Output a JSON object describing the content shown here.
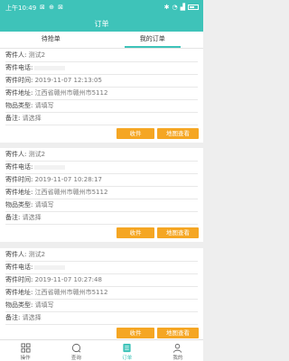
{
  "status": {
    "time": "上午10:49",
    "left_icons": "⊠ ⊕ ⊠"
  },
  "header": {
    "title": "订单"
  },
  "tabs": [
    {
      "label": "待抢单"
    },
    {
      "label": "我的订单"
    }
  ],
  "orders": [
    {
      "sender_label": "寄件人:",
      "sender": "测试2",
      "phone_label": "寄件电话:",
      "time_label": "寄件时间:",
      "time": "2019-11-07 12:13:05",
      "address_label": "寄件地址:",
      "address": "江西省赣州市赣州市5112",
      "type_label": "物品类型:",
      "type": "请填写",
      "note_label": "备注:",
      "note": "请选择",
      "btn_receive": "收件",
      "btn_map": "地图查看"
    },
    {
      "sender_label": "寄件人:",
      "sender": "测试2",
      "phone_label": "寄件电话:",
      "time_label": "寄件时间:",
      "time": "2019-11-07 10:28:17",
      "address_label": "寄件地址:",
      "address": "江西省赣州市赣州市5112",
      "type_label": "物品类型:",
      "type": "请填写",
      "note_label": "备注:",
      "note": "请选择",
      "btn_receive": "收件",
      "btn_map": "地图查看"
    },
    {
      "sender_label": "寄件人:",
      "sender": "测试2",
      "phone_label": "寄件电话:",
      "time_label": "寄件时间:",
      "time": "2019-11-07 10:27:48",
      "address_label": "寄件地址:",
      "address": "江西省赣州市赣州市5112",
      "type_label": "物品类型:",
      "type": "请填写",
      "note_label": "备注:",
      "note": "请选择",
      "btn_receive": "收件",
      "btn_map": "地图查看"
    }
  ],
  "nav": [
    {
      "label": "操作",
      "icon": "grid-icon"
    },
    {
      "label": "查询",
      "icon": "chat-icon"
    },
    {
      "label": "订单",
      "icon": "list-icon"
    },
    {
      "label": "我的",
      "icon": "person-icon"
    }
  ],
  "colors": {
    "accent": "#3ec3b9",
    "button": "#f5a623"
  }
}
